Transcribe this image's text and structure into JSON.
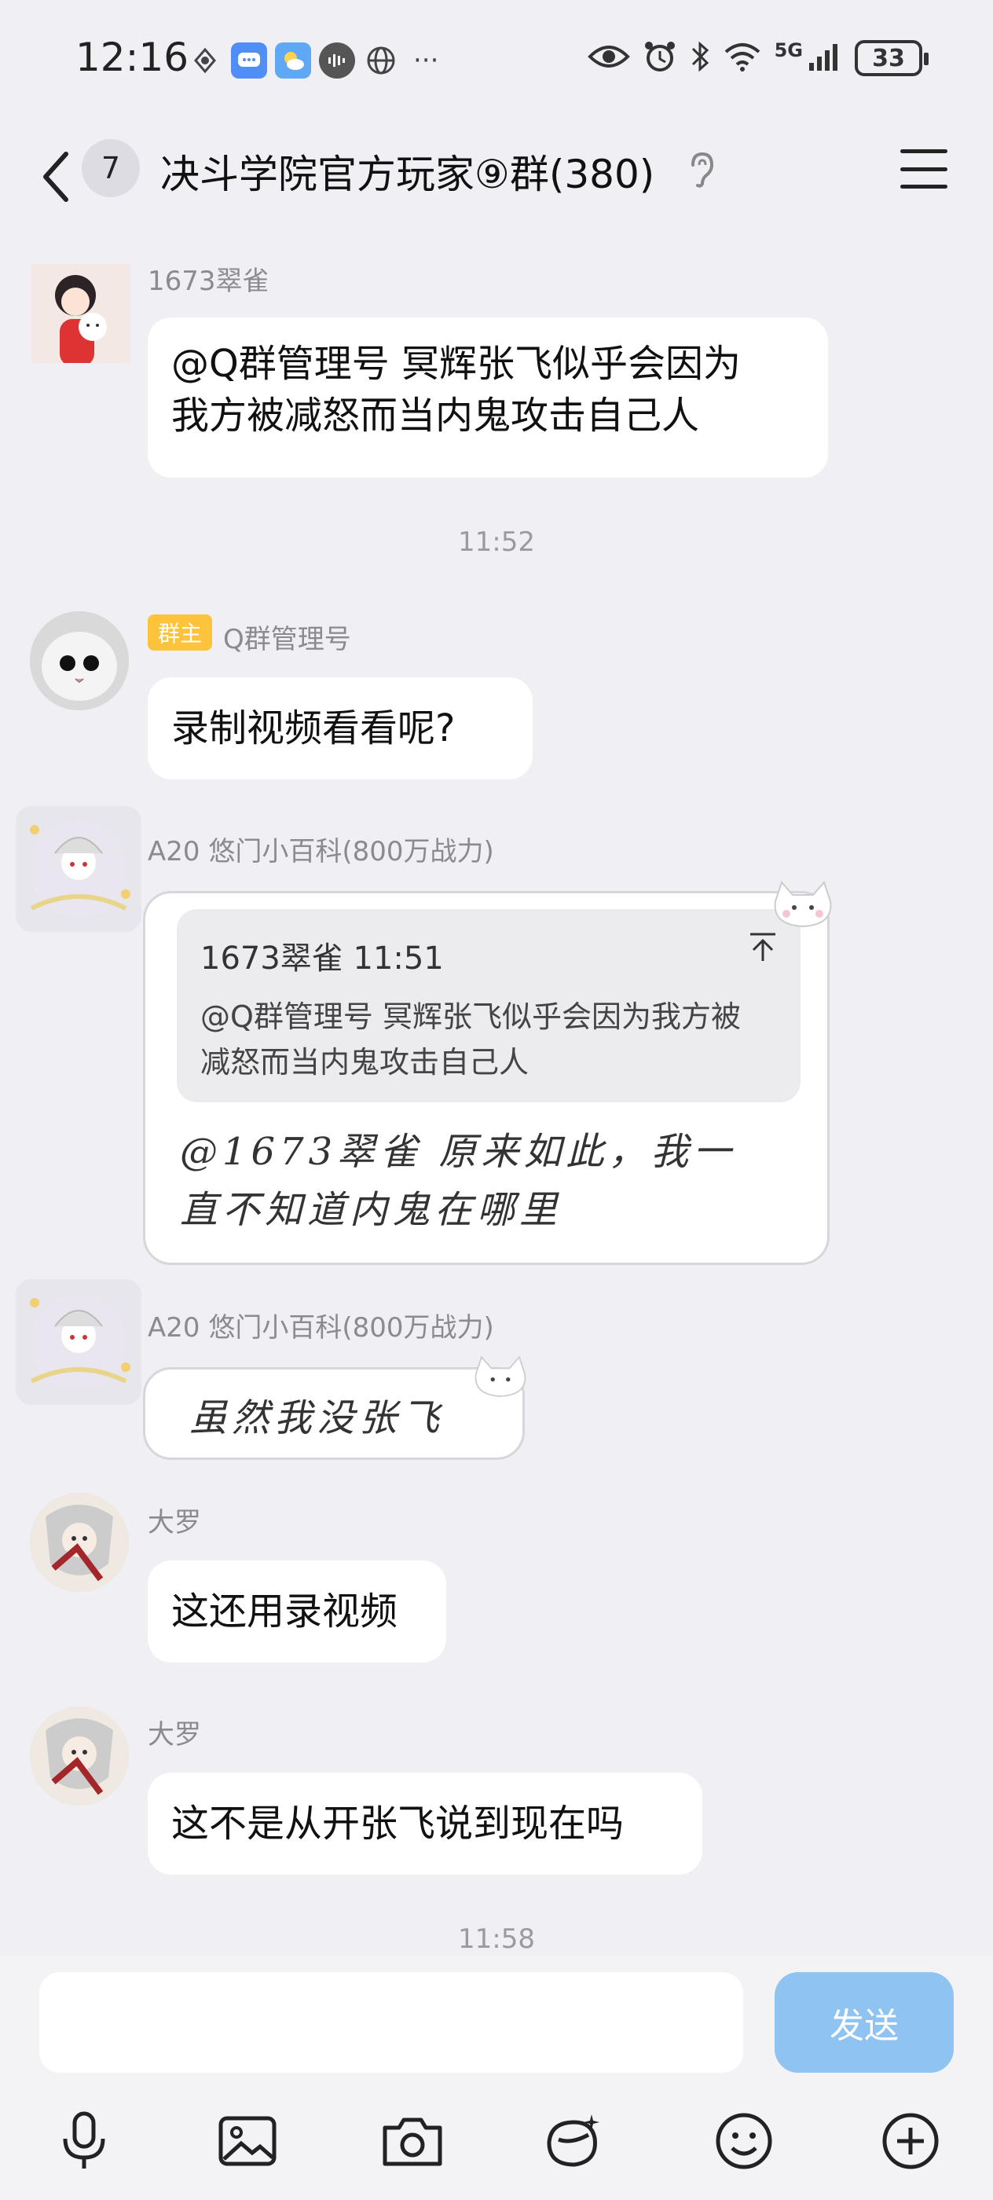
{
  "status": {
    "time": "12:16",
    "network": "5G",
    "battery": "33"
  },
  "header": {
    "unread_count": "7",
    "title": "决斗学院官方玩家⑨群(380)"
  },
  "messages": [
    {
      "sender": "1673翠雀",
      "text_line1": "@Q群管理号 冥辉张飞似乎会因为",
      "text_line2": "我方被减怒而当内鬼攻击自己人"
    },
    {
      "time": "11:52"
    },
    {
      "badge": "群主",
      "sender": "Q群管理号",
      "text": "录制视频看看呢?"
    },
    {
      "sender": "A20 悠门小百科(800万战力)",
      "quote_author": "1673翠雀",
      "quote_time": "11:51",
      "quote_line1": "@Q群管理号 冥辉张飞似乎会因为我方被",
      "quote_line2": "减怒而当内鬼攻击自己人",
      "text_line1": "@1673翠雀 原来如此，我一",
      "text_line2": "直不知道内鬼在哪里"
    },
    {
      "sender": "A20 悠门小百科(800万战力)",
      "text": "虽然我没张飞"
    },
    {
      "sender": "大罗",
      "text": "这还用录视频"
    },
    {
      "sender": "大罗",
      "text": "这不是从开张飞说到现在吗"
    },
    {
      "time": "11:58"
    }
  ],
  "composer": {
    "placeholder": "",
    "send_label": "发送"
  }
}
